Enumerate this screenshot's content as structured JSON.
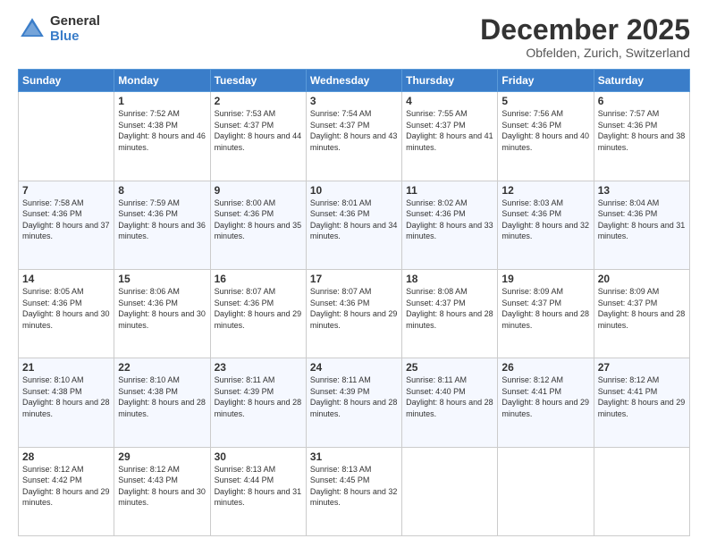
{
  "logo": {
    "general": "General",
    "blue": "Blue"
  },
  "header": {
    "month": "December 2025",
    "location": "Obfelden, Zurich, Switzerland"
  },
  "days_of_week": [
    "Sunday",
    "Monday",
    "Tuesday",
    "Wednesday",
    "Thursday",
    "Friday",
    "Saturday"
  ],
  "weeks": [
    [
      {
        "day": "",
        "sunrise": "",
        "sunset": "",
        "daylight": ""
      },
      {
        "day": "1",
        "sunrise": "Sunrise: 7:52 AM",
        "sunset": "Sunset: 4:38 PM",
        "daylight": "Daylight: 8 hours and 46 minutes."
      },
      {
        "day": "2",
        "sunrise": "Sunrise: 7:53 AM",
        "sunset": "Sunset: 4:37 PM",
        "daylight": "Daylight: 8 hours and 44 minutes."
      },
      {
        "day": "3",
        "sunrise": "Sunrise: 7:54 AM",
        "sunset": "Sunset: 4:37 PM",
        "daylight": "Daylight: 8 hours and 43 minutes."
      },
      {
        "day": "4",
        "sunrise": "Sunrise: 7:55 AM",
        "sunset": "Sunset: 4:37 PM",
        "daylight": "Daylight: 8 hours and 41 minutes."
      },
      {
        "day": "5",
        "sunrise": "Sunrise: 7:56 AM",
        "sunset": "Sunset: 4:36 PM",
        "daylight": "Daylight: 8 hours and 40 minutes."
      },
      {
        "day": "6",
        "sunrise": "Sunrise: 7:57 AM",
        "sunset": "Sunset: 4:36 PM",
        "daylight": "Daylight: 8 hours and 38 minutes."
      }
    ],
    [
      {
        "day": "7",
        "sunrise": "Sunrise: 7:58 AM",
        "sunset": "Sunset: 4:36 PM",
        "daylight": "Daylight: 8 hours and 37 minutes."
      },
      {
        "day": "8",
        "sunrise": "Sunrise: 7:59 AM",
        "sunset": "Sunset: 4:36 PM",
        "daylight": "Daylight: 8 hours and 36 minutes."
      },
      {
        "day": "9",
        "sunrise": "Sunrise: 8:00 AM",
        "sunset": "Sunset: 4:36 PM",
        "daylight": "Daylight: 8 hours and 35 minutes."
      },
      {
        "day": "10",
        "sunrise": "Sunrise: 8:01 AM",
        "sunset": "Sunset: 4:36 PM",
        "daylight": "Daylight: 8 hours and 34 minutes."
      },
      {
        "day": "11",
        "sunrise": "Sunrise: 8:02 AM",
        "sunset": "Sunset: 4:36 PM",
        "daylight": "Daylight: 8 hours and 33 minutes."
      },
      {
        "day": "12",
        "sunrise": "Sunrise: 8:03 AM",
        "sunset": "Sunset: 4:36 PM",
        "daylight": "Daylight: 8 hours and 32 minutes."
      },
      {
        "day": "13",
        "sunrise": "Sunrise: 8:04 AM",
        "sunset": "Sunset: 4:36 PM",
        "daylight": "Daylight: 8 hours and 31 minutes."
      }
    ],
    [
      {
        "day": "14",
        "sunrise": "Sunrise: 8:05 AM",
        "sunset": "Sunset: 4:36 PM",
        "daylight": "Daylight: 8 hours and 30 minutes."
      },
      {
        "day": "15",
        "sunrise": "Sunrise: 8:06 AM",
        "sunset": "Sunset: 4:36 PM",
        "daylight": "Daylight: 8 hours and 30 minutes."
      },
      {
        "day": "16",
        "sunrise": "Sunrise: 8:07 AM",
        "sunset": "Sunset: 4:36 PM",
        "daylight": "Daylight: 8 hours and 29 minutes."
      },
      {
        "day": "17",
        "sunrise": "Sunrise: 8:07 AM",
        "sunset": "Sunset: 4:36 PM",
        "daylight": "Daylight: 8 hours and 29 minutes."
      },
      {
        "day": "18",
        "sunrise": "Sunrise: 8:08 AM",
        "sunset": "Sunset: 4:37 PM",
        "daylight": "Daylight: 8 hours and 28 minutes."
      },
      {
        "day": "19",
        "sunrise": "Sunrise: 8:09 AM",
        "sunset": "Sunset: 4:37 PM",
        "daylight": "Daylight: 8 hours and 28 minutes."
      },
      {
        "day": "20",
        "sunrise": "Sunrise: 8:09 AM",
        "sunset": "Sunset: 4:37 PM",
        "daylight": "Daylight: 8 hours and 28 minutes."
      }
    ],
    [
      {
        "day": "21",
        "sunrise": "Sunrise: 8:10 AM",
        "sunset": "Sunset: 4:38 PM",
        "daylight": "Daylight: 8 hours and 28 minutes."
      },
      {
        "day": "22",
        "sunrise": "Sunrise: 8:10 AM",
        "sunset": "Sunset: 4:38 PM",
        "daylight": "Daylight: 8 hours and 28 minutes."
      },
      {
        "day": "23",
        "sunrise": "Sunrise: 8:11 AM",
        "sunset": "Sunset: 4:39 PM",
        "daylight": "Daylight: 8 hours and 28 minutes."
      },
      {
        "day": "24",
        "sunrise": "Sunrise: 8:11 AM",
        "sunset": "Sunset: 4:39 PM",
        "daylight": "Daylight: 8 hours and 28 minutes."
      },
      {
        "day": "25",
        "sunrise": "Sunrise: 8:11 AM",
        "sunset": "Sunset: 4:40 PM",
        "daylight": "Daylight: 8 hours and 28 minutes."
      },
      {
        "day": "26",
        "sunrise": "Sunrise: 8:12 AM",
        "sunset": "Sunset: 4:41 PM",
        "daylight": "Daylight: 8 hours and 29 minutes."
      },
      {
        "day": "27",
        "sunrise": "Sunrise: 8:12 AM",
        "sunset": "Sunset: 4:41 PM",
        "daylight": "Daylight: 8 hours and 29 minutes."
      }
    ],
    [
      {
        "day": "28",
        "sunrise": "Sunrise: 8:12 AM",
        "sunset": "Sunset: 4:42 PM",
        "daylight": "Daylight: 8 hours and 29 minutes."
      },
      {
        "day": "29",
        "sunrise": "Sunrise: 8:12 AM",
        "sunset": "Sunset: 4:43 PM",
        "daylight": "Daylight: 8 hours and 30 minutes."
      },
      {
        "day": "30",
        "sunrise": "Sunrise: 8:13 AM",
        "sunset": "Sunset: 4:44 PM",
        "daylight": "Daylight: 8 hours and 31 minutes."
      },
      {
        "day": "31",
        "sunrise": "Sunrise: 8:13 AM",
        "sunset": "Sunset: 4:45 PM",
        "daylight": "Daylight: 8 hours and 32 minutes."
      },
      {
        "day": "",
        "sunrise": "",
        "sunset": "",
        "daylight": ""
      },
      {
        "day": "",
        "sunrise": "",
        "sunset": "",
        "daylight": ""
      },
      {
        "day": "",
        "sunrise": "",
        "sunset": "",
        "daylight": ""
      }
    ]
  ]
}
